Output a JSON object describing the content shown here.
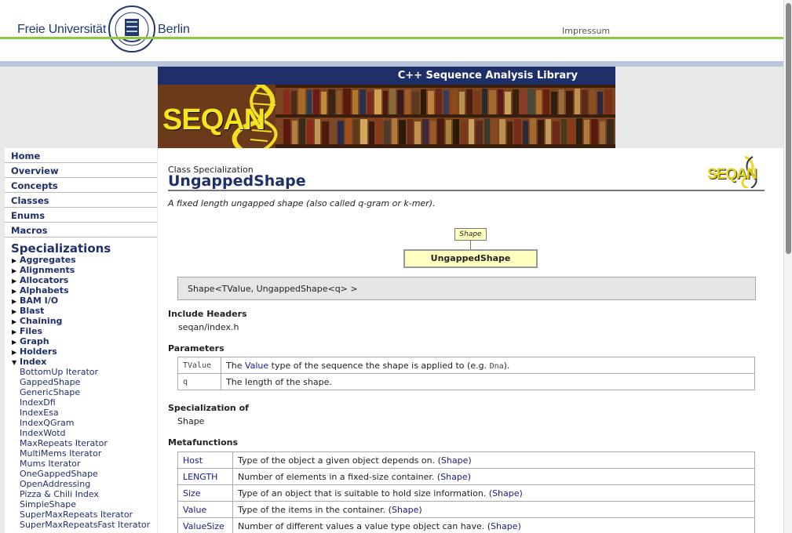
{
  "header": {
    "university_left": "Freie Universität",
    "university_right": "Berlin",
    "impressum": "Impressum",
    "seal_text": "VERITAS IUSTITIA LIBERTAS",
    "accent_green": "#8dc63f",
    "accent_blue": "#b8c6dc"
  },
  "banner": {
    "tagline": "C++ Sequence Analysis Library",
    "logo_text": "SEQAN"
  },
  "sidebar": {
    "nav": [
      "Home",
      "Overview",
      "Concepts",
      "Classes",
      "Enums",
      "Macros"
    ],
    "section_title": "Specializations",
    "categories": [
      "Aggregates",
      "Alignments",
      "Allocators",
      "Alphabets",
      "BAM I/O",
      "Blast",
      "Chaining",
      "Files",
      "Graph",
      "Holders"
    ],
    "expanded_category": "Index",
    "subitems": [
      "BottomUp Iterator",
      "GappedShape",
      "GenericShape",
      "IndexDfi",
      "IndexEsa",
      "IndexQGram",
      "IndexWotd",
      "MaxRepeats Iterator",
      "MultiMems Iterator",
      "Mums Iterator",
      "OneGappedShape",
      "OpenAddressing",
      "Pizza & Chili Index",
      "SimpleShape",
      "SuperMaxRepeats Iterator",
      "SuperMaxRepeatsFast Iterator"
    ]
  },
  "main": {
    "kind": "Class Specialization",
    "title": "UngappedShape",
    "logo_text": "SEQAN",
    "summary": "A fixed length ungapped shape (also called q-gram or k-mer).",
    "diagram": {
      "parent": "Shape",
      "self": "UngappedShape"
    },
    "signature": "Shape<TValue, UngappedShape<q> >",
    "include_headers_label": "Include Headers",
    "include_header": "seqan/index.h",
    "parameters_label": "Parameters",
    "parameters": [
      {
        "name": "TValue",
        "desc_pre": "The ",
        "desc_link": "Value",
        "desc_mid": " type of the sequence the shape is applied to (e.g. ",
        "desc_code": "Dna",
        "desc_post": ")."
      },
      {
        "name": "q",
        "desc_pre": "The length of the shape.",
        "desc_link": "",
        "desc_mid": "",
        "desc_code": "",
        "desc_post": ""
      }
    ],
    "specialization_of_label": "Specialization of",
    "specialization_of": "Shape",
    "metafunctions_label": "Metafunctions",
    "metafunctions": [
      {
        "name": "Host",
        "desc": "Type of the object a given object depends on. (",
        "link": "Shape",
        "end": ")"
      },
      {
        "name": "LENGTH",
        "desc": "Number of elements in a fixed-size container. (",
        "link": "Shape",
        "end": ")"
      },
      {
        "name": "Size",
        "desc": "Type of an object that is suitable to hold size information. (",
        "link": "Shape",
        "end": ")"
      },
      {
        "name": "Value",
        "desc": "Type of the items in the container. (",
        "link": "Shape",
        "end": ")"
      },
      {
        "name": "ValueSize",
        "desc": "Number of different values a value type object can have. (",
        "link": "Shape",
        "end": ")"
      }
    ]
  }
}
